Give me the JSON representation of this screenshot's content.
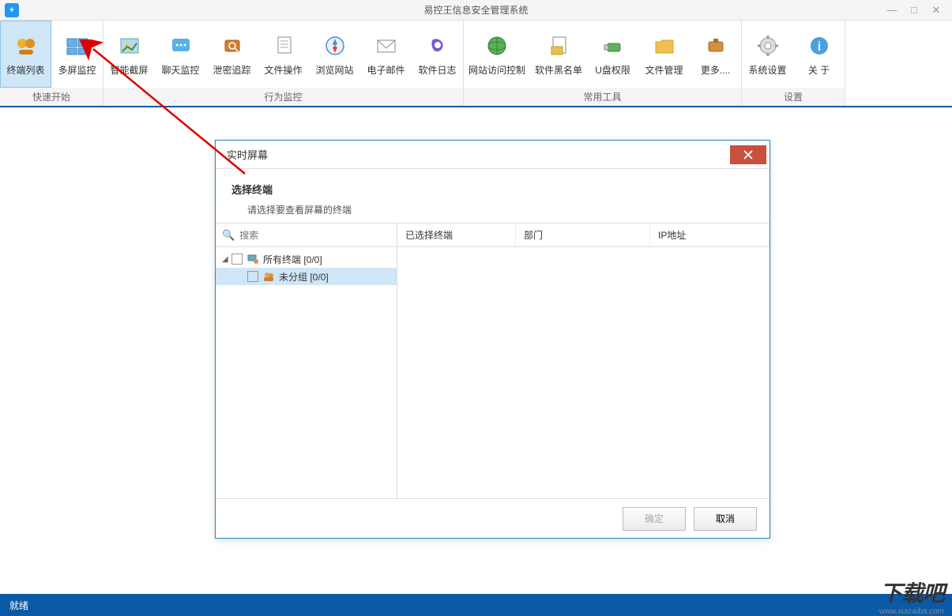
{
  "title": "易控王信息安全管理系统",
  "ribbon": {
    "groups": [
      {
        "label": "快速开始",
        "items": [
          {
            "label": "终端列表",
            "icon": "terminals-icon",
            "active": true
          },
          {
            "label": "多屏监控",
            "icon": "multiscreen-icon"
          }
        ]
      },
      {
        "label": "行为监控",
        "items": [
          {
            "label": "智能截屏",
            "icon": "screenshot-icon"
          },
          {
            "label": "聊天监控",
            "icon": "chat-icon"
          },
          {
            "label": "泄密追踪",
            "icon": "leak-icon"
          },
          {
            "label": "文件操作",
            "icon": "fileop-icon"
          },
          {
            "label": "浏览网站",
            "icon": "browse-icon"
          },
          {
            "label": "电子邮件",
            "icon": "email-icon"
          },
          {
            "label": "软件日志",
            "icon": "softlog-icon"
          }
        ]
      },
      {
        "label": "常用工具",
        "items": [
          {
            "label": "网站访问控制",
            "icon": "webctrl-icon"
          },
          {
            "label": "软件黑名单",
            "icon": "blacklist-icon"
          },
          {
            "label": "U盘权限",
            "icon": "usb-icon"
          },
          {
            "label": "文件管理",
            "icon": "filemgr-icon"
          },
          {
            "label": "更多....",
            "icon": "more-icon"
          }
        ]
      },
      {
        "label": "设置",
        "items": [
          {
            "label": "系统设置",
            "icon": "settings-icon"
          },
          {
            "label": "关  于",
            "icon": "about-icon"
          }
        ]
      }
    ]
  },
  "dialog": {
    "title": "实时屏幕",
    "section_title": "选择终端",
    "section_desc": "请选择要查看屏幕的终端",
    "search_placeholder": "搜索",
    "tree": [
      {
        "label": "所有终端  [0/0]",
        "level": 0
      },
      {
        "label": "未分组  [0/0]",
        "level": 1,
        "selected": true
      }
    ],
    "columns": [
      "已选择终端",
      "部门",
      "IP地址"
    ],
    "ok": "确定",
    "cancel": "取消"
  },
  "status": "就绪",
  "watermark": "下载吧",
  "watermark_url": "www.xiazaiba.com"
}
